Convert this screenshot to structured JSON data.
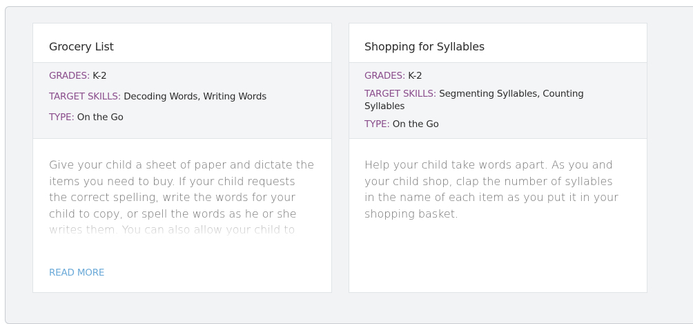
{
  "cards": [
    {
      "title": "Grocery List",
      "grades_label": "GRADES:",
      "grades_value": " K-2",
      "skills_label": "TARGET SKILLS:",
      "skills_value": " Decoding Words, Writing Words",
      "type_label": "TYPE:",
      "type_value": " On the Go",
      "description": "Give your child a sheet of paper and dictate the items you need to buy. If your child requests the correct spelling, write the words for your child to copy, or spell the words as he or she writes them. You can also allow your child to use inventive spelling for items on the list and locate",
      "read_more": "READ MORE"
    },
    {
      "title": "Shopping for Syllables",
      "grades_label": "GRADES:",
      "grades_value": " K-2",
      "skills_label": "TARGET SKILLS:",
      "skills_value": " Segmenting Syllables, Counting Syllables",
      "type_label": "TYPE:",
      "type_value": " On the Go",
      "description": "Help your child take words apart. As you and your child shop, clap the number of syllables in the name of each item as you put it in your shopping basket."
    }
  ],
  "colors": {
    "label": "#8a4d8c",
    "link": "#6aa9d8",
    "panel": "#f1f3f5"
  }
}
